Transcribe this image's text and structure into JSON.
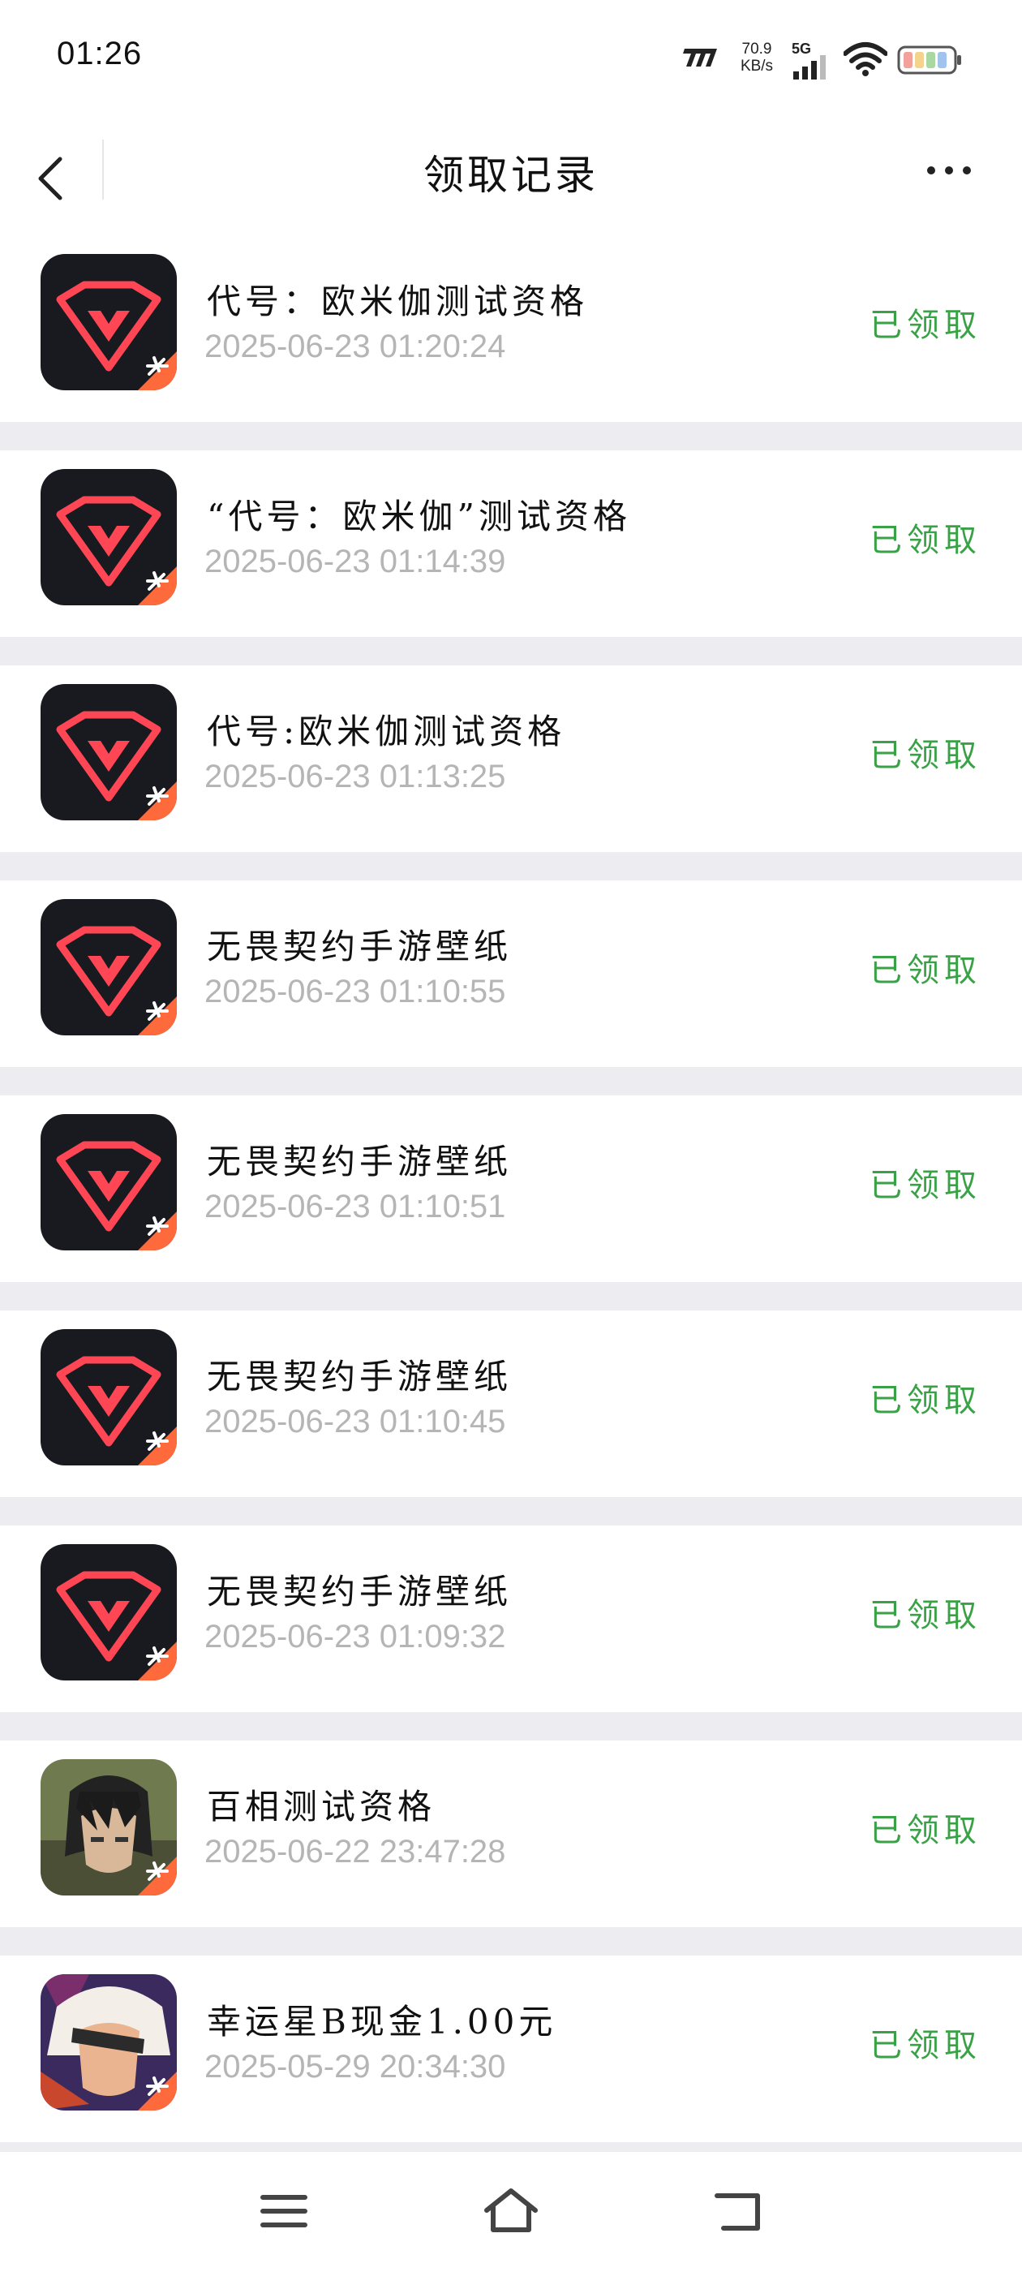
{
  "status_bar": {
    "time": "01:26",
    "net_speed_value": "70.9",
    "net_speed_unit": "KB/s",
    "network_type": "5G"
  },
  "header": {
    "title": "领取记录"
  },
  "records": [
    {
      "title": "代号：欧米伽测试资格",
      "time": "2025-06-23 01:20:24",
      "status": "已领取",
      "icon": "valorant-icon"
    },
    {
      "title": "“代号：欧米伽”测试资格",
      "time": "2025-06-23 01:14:39",
      "status": "已领取",
      "icon": "valorant-icon"
    },
    {
      "title": "代号:欧米伽测试资格",
      "time": "2025-06-23 01:13:25",
      "status": "已领取",
      "icon": "valorant-icon"
    },
    {
      "title": "无畏契约手游壁纸",
      "time": "2025-06-23 01:10:55",
      "status": "已领取",
      "icon": "valorant-icon"
    },
    {
      "title": "无畏契约手游壁纸",
      "time": "2025-06-23 01:10:51",
      "status": "已领取",
      "icon": "valorant-icon"
    },
    {
      "title": "无畏契约手游壁纸",
      "time": "2025-06-23 01:10:45",
      "status": "已领取",
      "icon": "valorant-icon"
    },
    {
      "title": "无畏契约手游壁纸",
      "time": "2025-06-23 01:09:32",
      "status": "已领取",
      "icon": "valorant-icon"
    },
    {
      "title": "百相测试资格",
      "time": "2025-06-22 23:47:28",
      "status": "已领取",
      "icon": "anime-character-icon"
    },
    {
      "title": "幸运星B现金1.00元",
      "time": "2025-05-29 20:34:30",
      "status": "已领取",
      "icon": "hero-character-icon"
    }
  ],
  "colors": {
    "status_green": "#3aa246",
    "time_gray": "#b5b5b5",
    "separator": "#ededf1",
    "valorant_bg": "#181a20",
    "valorant_red": "#ff4655"
  },
  "nav": {
    "icons": [
      "menu-icon",
      "home-icon",
      "back-nav-icon"
    ]
  }
}
